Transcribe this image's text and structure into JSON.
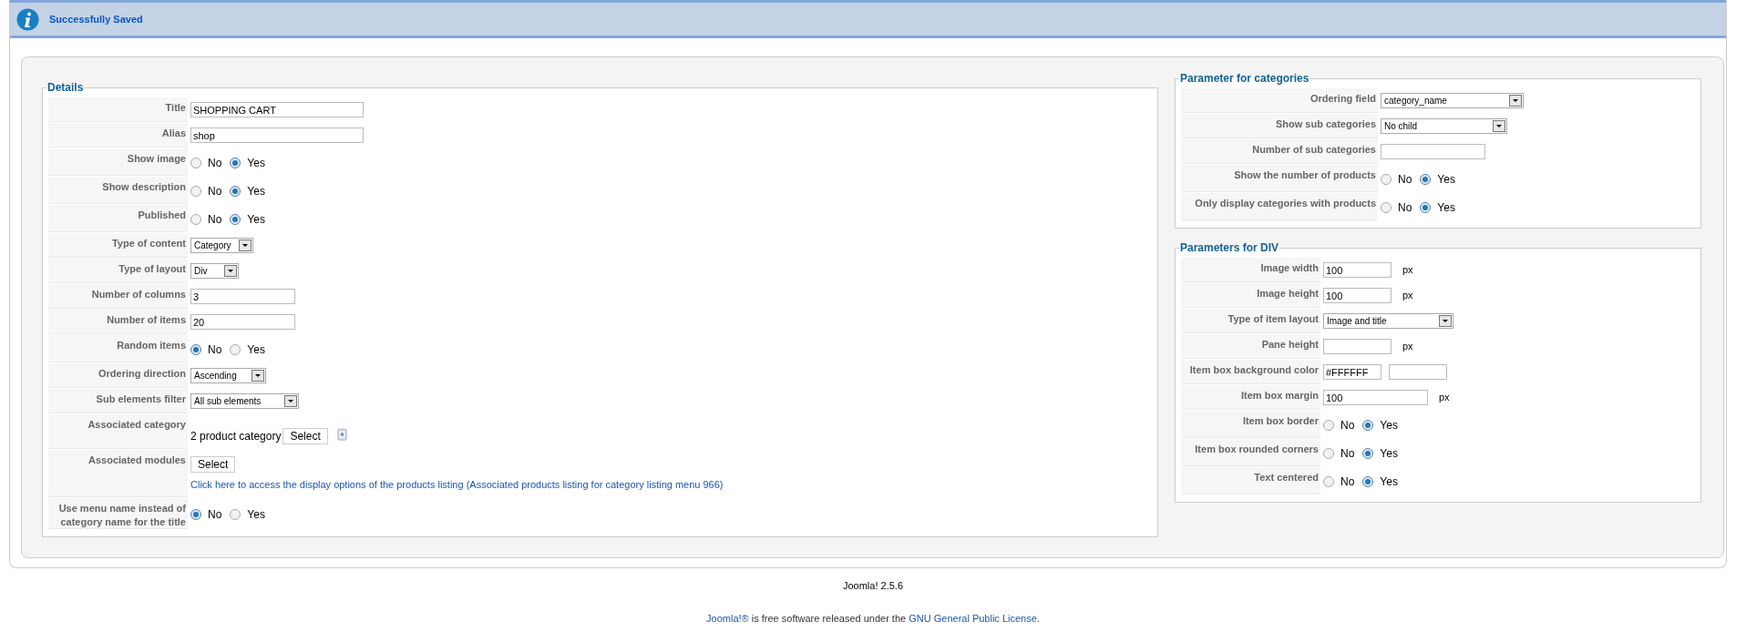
{
  "message": {
    "text": "Successfully Saved"
  },
  "sections": [
    {
      "title": "Details",
      "rows": [
        {
          "kind": "text",
          "label": "Title",
          "value": "SHOPPING CART"
        },
        {
          "kind": "text",
          "label": "Alias",
          "value": "shop"
        },
        {
          "kind": "radio",
          "label": "Show image",
          "options": [
            {
              "label": "No",
              "selected": false
            },
            {
              "label": "Yes",
              "selected": true
            }
          ]
        },
        {
          "kind": "radio",
          "label": "Show description",
          "options": [
            {
              "label": "No",
              "selected": false
            },
            {
              "label": "Yes",
              "selected": true
            }
          ]
        },
        {
          "kind": "radio",
          "label": "Published",
          "options": [
            {
              "label": "No",
              "selected": false
            },
            {
              "label": "Yes",
              "selected": true
            }
          ]
        },
        {
          "kind": "select",
          "label": "Type of content",
          "value": "Category"
        },
        {
          "kind": "select",
          "label": "Type of layout",
          "value": "Div"
        },
        {
          "kind": "text",
          "label": "Number of columns",
          "value": "3"
        },
        {
          "kind": "text",
          "label": "Number of items",
          "value": "20"
        },
        {
          "kind": "radio",
          "label": "Random items",
          "options": [
            {
              "label": "No",
              "selected": true
            },
            {
              "label": "Yes",
              "selected": false
            }
          ]
        },
        {
          "kind": "select",
          "label": "Ordering direction",
          "value": "Ascending"
        },
        {
          "kind": "select",
          "label": "Sub elements filter",
          "value": "All sub elements"
        },
        {
          "kind": "category",
          "label": "Associated category",
          "value": "2 product category",
          "button": "Select"
        },
        {
          "kind": "modules",
          "label": "Associated modules",
          "button": "Select",
          "link": "Click here to access the display options of the products listing (Associated products listing for category listing menu 966)"
        },
        {
          "kind": "radio",
          "label": "Use menu name instead of category name for the title",
          "options": [
            {
              "label": "No",
              "selected": true
            },
            {
              "label": "Yes",
              "selected": false
            }
          ]
        }
      ]
    },
    {
      "title": "Parameter for categories",
      "rows": [
        {
          "kind": "select",
          "label": "Ordering field",
          "value": "category_name"
        },
        {
          "kind": "select",
          "label": "Show sub categories",
          "value": "No child"
        },
        {
          "kind": "text",
          "label": "Number of sub categories"
        },
        {
          "kind": "radio",
          "label": "Show the number of products",
          "options": [
            {
              "label": "No",
              "selected": false
            },
            {
              "label": "Yes",
              "selected": true
            }
          ]
        },
        {
          "kind": "radio",
          "label": "Only display categories with products",
          "options": [
            {
              "label": "No",
              "selected": false
            },
            {
              "label": "Yes",
              "selected": true
            }
          ]
        }
      ]
    },
    {
      "title": "Parameters for DIV",
      "rows": [
        {
          "kind": "text",
          "label": "Image width",
          "value": "100",
          "unit": "px"
        },
        {
          "kind": "text",
          "label": "Image height",
          "value": "100",
          "unit": "px"
        },
        {
          "kind": "select",
          "label": "Type of item layout",
          "value": "Image and title"
        },
        {
          "kind": "text",
          "label": "Pane height",
          "unit": "px"
        },
        {
          "kind": "color",
          "label": "Item box background color",
          "value": "#FFFFFF"
        },
        {
          "kind": "text",
          "label": "Item box margin",
          "value": "100",
          "unit": "px"
        },
        {
          "kind": "radio",
          "label": "Item box border",
          "options": [
            {
              "label": "No",
              "selected": false
            },
            {
              "label": "Yes",
              "selected": true
            }
          ]
        },
        {
          "kind": "radio",
          "label": "Item box rounded corners",
          "options": [
            {
              "label": "No",
              "selected": false
            },
            {
              "label": "Yes",
              "selected": true
            }
          ]
        },
        {
          "kind": "radio",
          "label": "Text centered",
          "options": [
            {
              "label": "No",
              "selected": false
            },
            {
              "label": "Yes",
              "selected": true
            }
          ]
        }
      ]
    }
  ],
  "footer": {
    "version": "Joomla! 2.5.6",
    "license": [
      {
        "text": "Joomla!®",
        "link": true
      },
      {
        "text": "is free software released under the",
        "link": false
      },
      {
        "text": "GNU General Public License",
        "link": true
      },
      {
        "text": ".",
        "link": false
      }
    ]
  }
}
